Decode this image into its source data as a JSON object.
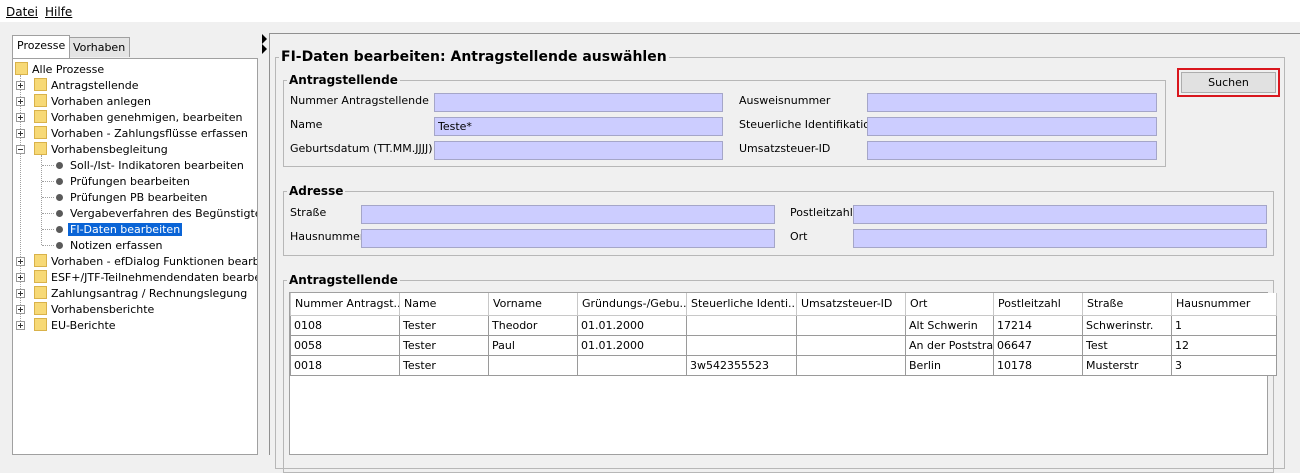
{
  "menu": {
    "file": "Datei",
    "help": "Hilfe"
  },
  "left_tabs": [
    "Prozesse",
    "Vorhaben"
  ],
  "tree": {
    "root": "Alle Prozesse",
    "items": [
      "Antragstellende",
      "Vorhaben anlegen",
      "Vorhaben genehmigen, bearbeiten",
      "Vorhaben - Zahlungsflüsse erfassen",
      "Vorhabensbegleitung",
      "Soll-/Ist- Indikatoren bearbeiten",
      "Prüfungen bearbeiten",
      "Prüfungen PB bearbeiten",
      "Vergabeverfahren des Begünstigten bearbeiten",
      "FI-Daten bearbeiten",
      "Notizen erfassen",
      "Vorhaben - efDialog Funktionen bearbeiten",
      "ESF+/JTF-Teilnehmendendaten bearbeiten",
      "Zahlungsantrag / Rechnungslegung",
      "Vorhabensberichte",
      "EU-Berichte"
    ],
    "selected": "FI-Daten bearbeiten"
  },
  "page_title": "FI-Daten bearbeiten: Antragstellende auswählen",
  "search_button": "Suchen",
  "applicant": {
    "legend": "Antragstellende",
    "number_label": "Nummer Antragstellende",
    "number_value": "",
    "name_label": "Name",
    "name_value": "Teste*",
    "birthdate_label": "Geburtsdatum (TT.MM.JJJJ)",
    "birthdate_value": "",
    "id_card_label": "Ausweisnummer",
    "id_card_value": "",
    "tax_id_label": "Steuerliche Identifikation",
    "tax_id_value": "",
    "vat_id_label": "Umsatzsteuer-ID",
    "vat_id_value": ""
  },
  "address": {
    "legend": "Adresse",
    "street_label": "Straße",
    "street_value": "",
    "house_number_label": "Hausnummer",
    "house_number_value": "",
    "postcode_label": "Postleitzahl",
    "postcode_value": "",
    "city_label": "Ort",
    "city_value": ""
  },
  "results": {
    "legend": "Antragstellende",
    "columns": [
      "Nummer Antragst...",
      "Name",
      "Vorname",
      "Gründungs-/Gebu...",
      "Steuerliche Identi...",
      "Umsatzsteuer-ID",
      "Ort",
      "Postleitzahl",
      "Straße",
      "Hausnummer"
    ],
    "rows": [
      [
        "0108",
        "Tester",
        "Theodor",
        "01.01.2000",
        "",
        "",
        "Alt Schwerin",
        "17214",
        "Schwerinstr.",
        "1"
      ],
      [
        "0058",
        "Tester",
        "Paul",
        "01.01.2000",
        "",
        "",
        "An der Poststraße",
        "06647",
        "Test",
        "12"
      ],
      [
        "0018",
        "Tester",
        "",
        "",
        "3w542355523",
        "",
        "Berlin",
        "10178",
        "Musterstr",
        "3"
      ]
    ]
  }
}
